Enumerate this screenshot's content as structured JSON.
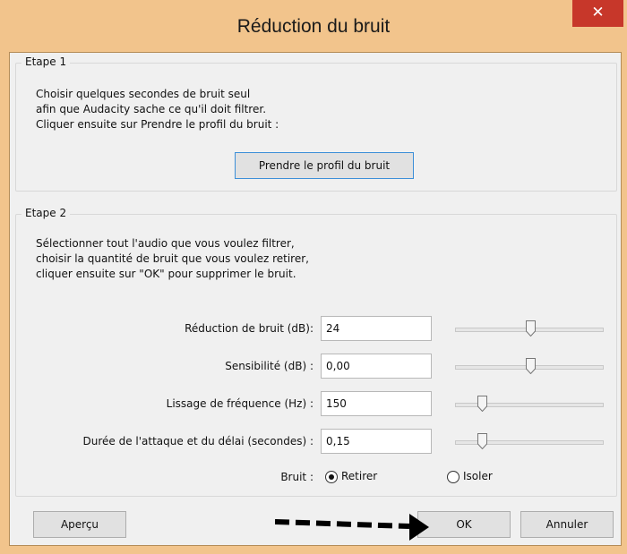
{
  "window": {
    "title": "Réduction du bruit",
    "close_symbol": "✕"
  },
  "step1": {
    "legend": "Etape 1",
    "lines": [
      "Choisir quelques secondes de bruit seul",
      "afin que Audacity sache ce qu'il doit filtrer.",
      "Cliquer ensuite sur Prendre le profil du bruit :"
    ],
    "profile_button": "Prendre le profil du bruit"
  },
  "step2": {
    "legend": "Etape 2",
    "lines": [
      "Sélectionner tout l'audio que vous voulez filtrer,",
      "choisir la quantité de bruit que vous voulez retirer,",
      "cliquer ensuite sur \"OK\" pour supprimer le bruit."
    ],
    "params": [
      {
        "label": "Réduction de bruit (dB):",
        "value": "24",
        "slider_level": 0.51
      },
      {
        "label": "Sensibilité (dB) :",
        "value": "0,00",
        "slider_level": 0.51
      },
      {
        "label": "Lissage de fréquence (Hz) :",
        "value": "150",
        "slider_level": 0.18
      },
      {
        "label": "Durée de l'attaque et du délai (secondes) :",
        "value": "0,15",
        "slider_level": 0.18
      }
    ],
    "noise_label": "Bruit :",
    "noise_options": [
      {
        "label": "Retirer",
        "selected": true
      },
      {
        "label": "Isoler",
        "selected": false
      }
    ]
  },
  "buttons": {
    "preview": "Aperçu",
    "ok": "OK",
    "cancel": "Annuler"
  },
  "colors": {
    "frame": "#f2c48c",
    "close": "#c7372a",
    "focus_border": "#3c8fd8"
  },
  "icons": {
    "close": "close-icon",
    "annotation": "dashed-arrow-icon"
  }
}
